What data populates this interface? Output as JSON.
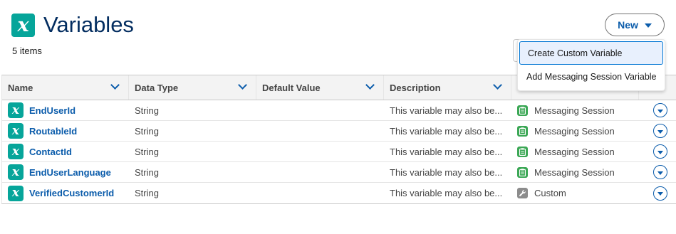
{
  "page": {
    "title": "Variables",
    "item_count": "5 items",
    "title_icon": "variable-x-icon",
    "icon_glyph": "x"
  },
  "new_button": {
    "label": "New",
    "icon": "chevron-down-icon"
  },
  "dropdown": {
    "items": [
      {
        "label": "Create Custom Variable",
        "highlighted": true
      },
      {
        "label": "Add Messaging Session Variable",
        "highlighted": false
      }
    ]
  },
  "table": {
    "columns": [
      {
        "label": "Name"
      },
      {
        "label": "Data Type"
      },
      {
        "label": "Default Value"
      },
      {
        "label": "Description"
      },
      {
        "label": ""
      },
      {
        "label": ""
      }
    ],
    "rows": [
      {
        "name": "EndUserId",
        "data_type": "String",
        "default_value": "",
        "description": "This variable may also be...",
        "category": "Messaging Session",
        "category_icon": "clipboard-icon",
        "category_color": "#3BA755"
      },
      {
        "name": "RoutableId",
        "data_type": "String",
        "default_value": "",
        "description": "This variable may also be...",
        "category": "Messaging Session",
        "category_icon": "clipboard-icon",
        "category_color": "#3BA755"
      },
      {
        "name": "ContactId",
        "data_type": "String",
        "default_value": "",
        "description": "This variable may also be...",
        "category": "Messaging Session",
        "category_icon": "clipboard-icon",
        "category_color": "#3BA755"
      },
      {
        "name": "EndUserLanguage",
        "data_type": "String",
        "default_value": "",
        "description": "This variable may also be...",
        "category": "Messaging Session",
        "category_icon": "clipboard-icon",
        "category_color": "#3BA755"
      },
      {
        "name": "VerifiedCustomerId",
        "data_type": "String",
        "default_value": "",
        "description": "This variable may also be...",
        "category": "Custom",
        "category_icon": "wrench-icon",
        "category_color": "#8c8c8c"
      }
    ]
  },
  "colors": {
    "brand_icon": "#06A59A",
    "link": "#0B5CAB",
    "title": "#032D60",
    "menu_highlight": "#e8f0fd"
  }
}
